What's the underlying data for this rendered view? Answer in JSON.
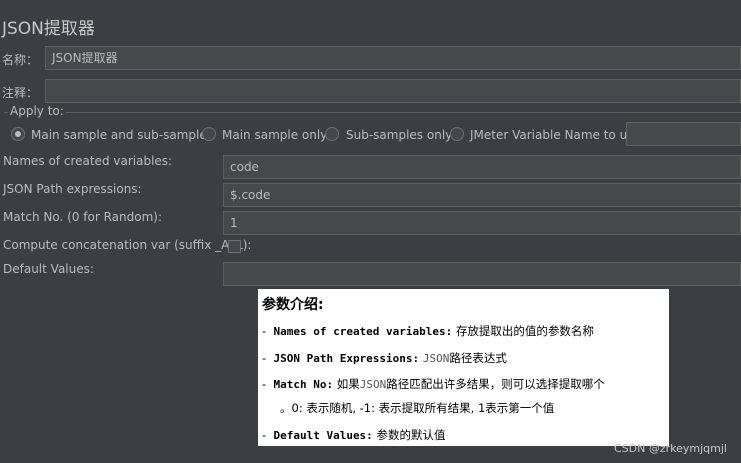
{
  "panel_title": "JSON提取器",
  "name_field": {
    "label": "名称：",
    "value": "JSON提取器"
  },
  "comment_field": {
    "label": "注释：",
    "value": ""
  },
  "apply_to": {
    "legend": "Apply to:",
    "options": [
      {
        "label": "Main sample and sub-samples",
        "selected": true
      },
      {
        "label": "Main sample only",
        "selected": false
      },
      {
        "label": "Sub-samples only",
        "selected": false
      },
      {
        "label": "JMeter Variable Name to use",
        "selected": false
      }
    ],
    "variable_value": ""
  },
  "fields": {
    "names_label": "Names of created variables:",
    "names_value": "code",
    "paths_label": "JSON Path expressions:",
    "paths_value": "$.code",
    "match_label": "Match No. (0 for Random):",
    "match_value": "1",
    "concat_label": "Compute concatenation var (suffix _ALL):",
    "concat_checked": false,
    "default_label": "Default Values:",
    "default_value": ""
  },
  "overlay": {
    "heading": "参数介绍:",
    "items": [
      {
        "dash": "-",
        "key": "Names of created variables:",
        "text": "存放提取出的值的参数名称"
      },
      {
        "dash": "-",
        "key": "JSON Path Expressions:",
        "text_mono": "JSON",
        "text": "路径表达式"
      },
      {
        "dash": "-",
        "key": "Match No:",
        "text_pre": "如果",
        "text_mono": "JSON",
        "text": "路径匹配出许多结果，则可以选择提取哪个"
      },
      {
        "dash": "",
        "key": "",
        "text": "。0: 表示随机, -1: 表示提取所有结果, 1表示第一个值"
      },
      {
        "dash": "-",
        "key": "Default Values:",
        "text": "参数的默认值"
      }
    ]
  },
  "watermark": "CSDN @zrkeymjqmjl"
}
